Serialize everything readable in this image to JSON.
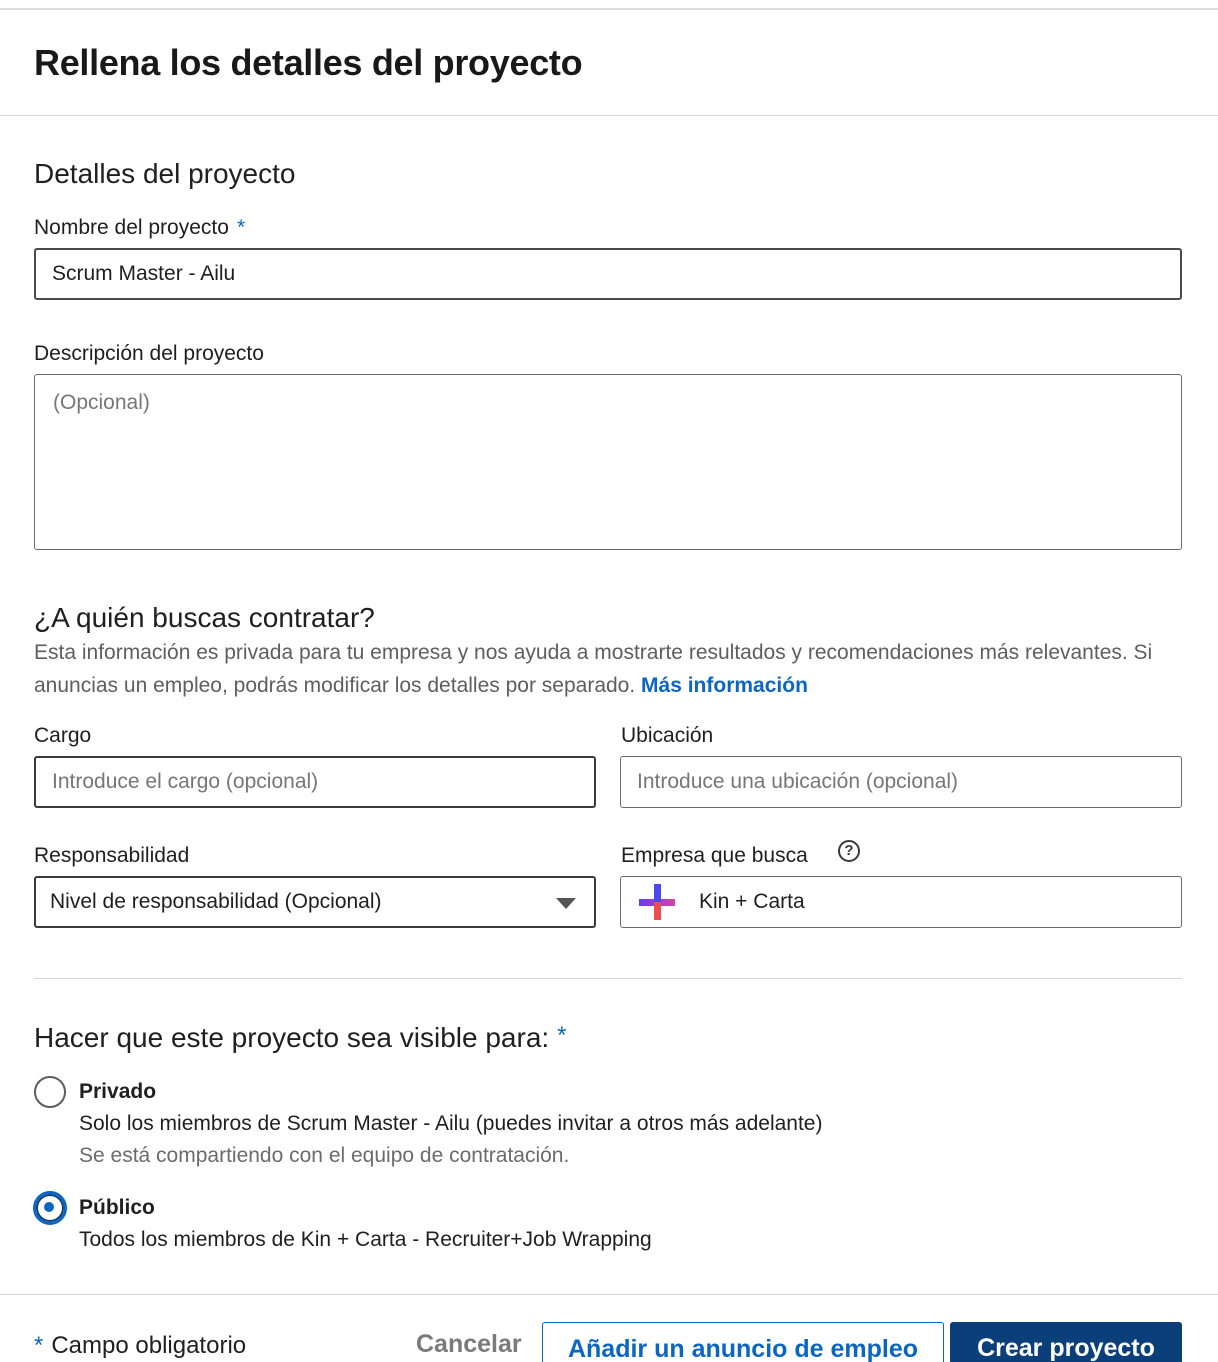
{
  "header": {
    "title": "Rellena los detalles del proyecto"
  },
  "project_details": {
    "section_title": "Detalles del proyecto",
    "name_label": "Nombre del proyecto",
    "required_mark": "*",
    "name_value": "Scrum Master - Ailu",
    "description_label": "Descripción del proyecto",
    "description_placeholder": "(Opcional)"
  },
  "hiring": {
    "section_title": "¿A quién buscas contratar?",
    "help_text": "Esta información es privada para tu empresa y nos ayuda a mostrarte resultados y recomendaciones más relevantes. Si anuncias un empleo, podrás modificar los detalles por separado.",
    "more_info_link": "Más información",
    "cargo_label": "Cargo",
    "cargo_placeholder": "Introduce el cargo (opcional)",
    "location_label": "Ubicación",
    "location_placeholder": "Introduce una ubicación (opcional)",
    "responsibility_label": "Responsabilidad",
    "responsibility_value": "Nivel de responsabilidad (Opcional)",
    "company_label": "Empresa que busca",
    "company_help_icon": "question-circle-icon",
    "company_value": "Kin + Carta"
  },
  "visibility": {
    "section_title": "Hacer que este proyecto sea visible para:",
    "required_mark": "*",
    "options": [
      {
        "title": "Privado",
        "description": "Solo los miembros de Scrum Master - Ailu (puedes invitar a otros más adelante)",
        "sub": "Se está compartiendo con el equipo de contratación.",
        "checked": false
      },
      {
        "title": "Público",
        "description": "Todos los miembros de Kin + Carta - Recruiter+Job Wrapping",
        "checked": true
      }
    ]
  },
  "footer": {
    "required_mark": "*",
    "required_note": "Campo obligatorio",
    "cancel_label": "Cancelar",
    "add_job_label": "Añadir un anuncio de empleo",
    "create_label": "Crear proyecto"
  },
  "colors": {
    "accent": "#0a66c2",
    "primary_button": "#0a3f7a"
  }
}
